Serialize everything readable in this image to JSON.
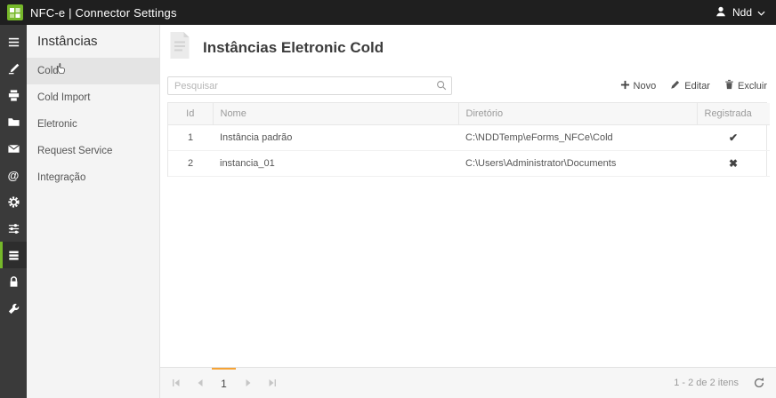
{
  "topbar": {
    "title": "NFC-e | Connector Settings",
    "user": "Ndd"
  },
  "accent_colors": {
    "green": "#76b82a",
    "orange": "#f6a335",
    "dark": "#1f1f1f"
  },
  "icons": {
    "sidebar": [
      "menu-icon",
      "tools-icon",
      "printer-icon",
      "folder-icon",
      "mail-icon",
      "at-icon",
      "gear-icon",
      "sliders-icon",
      "rows-icon",
      "lock-icon",
      "wrench-icon"
    ],
    "topbar": [
      "ndd-logo",
      "user-icon",
      "chevron-down-icon"
    ],
    "toolbar": [
      "plus-icon",
      "edit-icon",
      "trash-icon",
      "search-icon"
    ],
    "pager": [
      "first-page-icon",
      "prev-page-icon",
      "next-page-icon",
      "last-page-icon",
      "refresh-icon"
    ]
  },
  "menu": {
    "title": "Instâncias",
    "items": [
      {
        "label": "Cold",
        "selected": true
      },
      {
        "label": "Cold Import",
        "selected": false
      },
      {
        "label": "Eletronic",
        "selected": false
      },
      {
        "label": "Request Service",
        "selected": false
      },
      {
        "label": "Integração",
        "selected": false
      }
    ]
  },
  "main": {
    "title": "Instâncias Eletronic Cold",
    "search_placeholder": "Pesquisar",
    "toolbar": {
      "new": "Novo",
      "edit": "Editar",
      "delete": "Excluir"
    },
    "table": {
      "columns": [
        "Id",
        "Nome",
        "Diretório",
        "Registrada"
      ],
      "rows": [
        {
          "id": "1",
          "nome": "Instância padrão",
          "diretorio": "C:\\NDDTemp\\eForms_NFCe\\Cold",
          "registrada": "✔"
        },
        {
          "id": "2",
          "nome": "instancia_01",
          "diretorio": "C:\\Users\\Administrator\\Documents",
          "registrada": "✖"
        }
      ]
    },
    "pager": {
      "page": "1",
      "info": "1 - 2 de 2 itens"
    }
  }
}
